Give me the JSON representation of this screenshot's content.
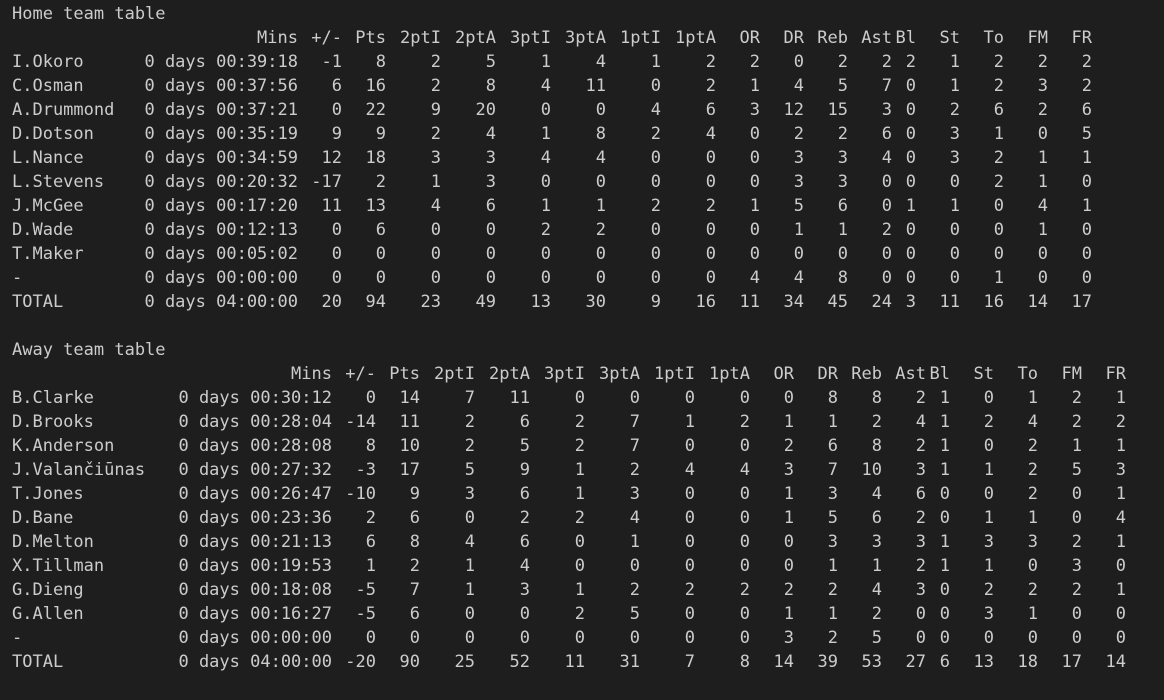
{
  "columns": [
    "Mins",
    "+/-",
    "Pts",
    "2ptI",
    "2ptA",
    "3ptI",
    "3ptA",
    "1ptI",
    "1ptA",
    "OR",
    "DR",
    "Reb",
    "Ast",
    "Bl",
    "St",
    "To",
    "FM",
    "FR"
  ],
  "home": {
    "title": "Home team table",
    "rows": [
      [
        "I.Okoro",
        "0 days 00:39:18",
        "-1",
        "8",
        "2",
        "5",
        "1",
        "4",
        "1",
        "2",
        "2",
        "0",
        "2",
        "2",
        "2",
        "1",
        "2",
        "2",
        "2"
      ],
      [
        "C.Osman",
        "0 days 00:37:56",
        "6",
        "16",
        "2",
        "8",
        "4",
        "11",
        "0",
        "2",
        "1",
        "4",
        "5",
        "7",
        "0",
        "1",
        "2",
        "3",
        "2"
      ],
      [
        "A.Drummond",
        "0 days 00:37:21",
        "0",
        "22",
        "9",
        "20",
        "0",
        "0",
        "4",
        "6",
        "3",
        "12",
        "15",
        "3",
        "0",
        "2",
        "6",
        "2",
        "6"
      ],
      [
        "D.Dotson",
        "0 days 00:35:19",
        "9",
        "9",
        "2",
        "4",
        "1",
        "8",
        "2",
        "4",
        "0",
        "2",
        "2",
        "6",
        "0",
        "3",
        "1",
        "0",
        "5"
      ],
      [
        "L.Nance",
        "0 days 00:34:59",
        "12",
        "18",
        "3",
        "3",
        "4",
        "4",
        "0",
        "0",
        "0",
        "3",
        "3",
        "4",
        "0",
        "3",
        "2",
        "1",
        "1"
      ],
      [
        "L.Stevens",
        "0 days 00:20:32",
        "-17",
        "2",
        "1",
        "3",
        "0",
        "0",
        "0",
        "0",
        "0",
        "3",
        "3",
        "0",
        "0",
        "0",
        "2",
        "1",
        "0"
      ],
      [
        "J.McGee",
        "0 days 00:17:20",
        "11",
        "13",
        "4",
        "6",
        "1",
        "1",
        "2",
        "2",
        "1",
        "5",
        "6",
        "0",
        "1",
        "1",
        "0",
        "4",
        "1"
      ],
      [
        "D.Wade",
        "0 days 00:12:13",
        "0",
        "6",
        "0",
        "0",
        "2",
        "2",
        "0",
        "0",
        "0",
        "1",
        "1",
        "2",
        "0",
        "0",
        "0",
        "1",
        "0"
      ],
      [
        "T.Maker",
        "0 days 00:05:02",
        "0",
        "0",
        "0",
        "0",
        "0",
        "0",
        "0",
        "0",
        "0",
        "0",
        "0",
        "0",
        "0",
        "0",
        "0",
        "0",
        "0"
      ],
      [
        "-",
        "0 days 00:00:00",
        "0",
        "0",
        "0",
        "0",
        "0",
        "0",
        "0",
        "0",
        "4",
        "4",
        "8",
        "0",
        "0",
        "0",
        "1",
        "0",
        "0"
      ],
      [
        "TOTAL",
        "0 days 04:00:00",
        "20",
        "94",
        "23",
        "49",
        "13",
        "30",
        "9",
        "16",
        "11",
        "34",
        "45",
        "24",
        "3",
        "11",
        "16",
        "14",
        "17"
      ]
    ]
  },
  "away": {
    "title": "Away team table",
    "rows": [
      [
        "B.Clarke",
        "0 days 00:30:12",
        "0",
        "14",
        "7",
        "11",
        "0",
        "0",
        "0",
        "0",
        "0",
        "8",
        "8",
        "2",
        "1",
        "0",
        "1",
        "2",
        "1"
      ],
      [
        "D.Brooks",
        "0 days 00:28:04",
        "-14",
        "11",
        "2",
        "6",
        "2",
        "7",
        "1",
        "2",
        "1",
        "1",
        "2",
        "4",
        "1",
        "2",
        "4",
        "2",
        "2"
      ],
      [
        "K.Anderson",
        "0 days 00:28:08",
        "8",
        "10",
        "2",
        "5",
        "2",
        "7",
        "0",
        "0",
        "2",
        "6",
        "8",
        "2",
        "1",
        "0",
        "2",
        "1",
        "1"
      ],
      [
        "J.Valančiūnas",
        "0 days 00:27:32",
        "-3",
        "17",
        "5",
        "9",
        "1",
        "2",
        "4",
        "4",
        "3",
        "7",
        "10",
        "3",
        "1",
        "1",
        "2",
        "5",
        "3"
      ],
      [
        "T.Jones",
        "0 days 00:26:47",
        "-10",
        "9",
        "3",
        "6",
        "1",
        "3",
        "0",
        "0",
        "1",
        "3",
        "4",
        "6",
        "0",
        "0",
        "2",
        "0",
        "1"
      ],
      [
        "D.Bane",
        "0 days 00:23:36",
        "2",
        "6",
        "0",
        "2",
        "2",
        "4",
        "0",
        "0",
        "1",
        "5",
        "6",
        "2",
        "0",
        "1",
        "1",
        "0",
        "4"
      ],
      [
        "D.Melton",
        "0 days 00:21:13",
        "6",
        "8",
        "4",
        "6",
        "0",
        "1",
        "0",
        "0",
        "0",
        "3",
        "3",
        "3",
        "1",
        "3",
        "3",
        "2",
        "1"
      ],
      [
        "X.Tillman",
        "0 days 00:19:53",
        "1",
        "2",
        "1",
        "4",
        "0",
        "0",
        "0",
        "0",
        "0",
        "1",
        "1",
        "2",
        "1",
        "1",
        "0",
        "3",
        "0"
      ],
      [
        "G.Dieng",
        "0 days 00:18:08",
        "-5",
        "7",
        "1",
        "3",
        "1",
        "2",
        "2",
        "2",
        "2",
        "2",
        "4",
        "3",
        "0",
        "2",
        "2",
        "2",
        "1"
      ],
      [
        "G.Allen",
        "0 days 00:16:27",
        "-5",
        "6",
        "0",
        "0",
        "2",
        "5",
        "0",
        "0",
        "1",
        "1",
        "2",
        "0",
        "0",
        "3",
        "1",
        "0",
        "0"
      ],
      [
        "-",
        "0 days 00:00:00",
        "0",
        "0",
        "0",
        "0",
        "0",
        "0",
        "0",
        "0",
        "3",
        "2",
        "5",
        "0",
        "0",
        "0",
        "0",
        "0",
        "0"
      ],
      [
        "TOTAL",
        "0 days 04:00:00",
        "-20",
        "90",
        "25",
        "52",
        "11",
        "31",
        "7",
        "8",
        "14",
        "39",
        "53",
        "27",
        "6",
        "13",
        "18",
        "17",
        "14"
      ]
    ]
  }
}
